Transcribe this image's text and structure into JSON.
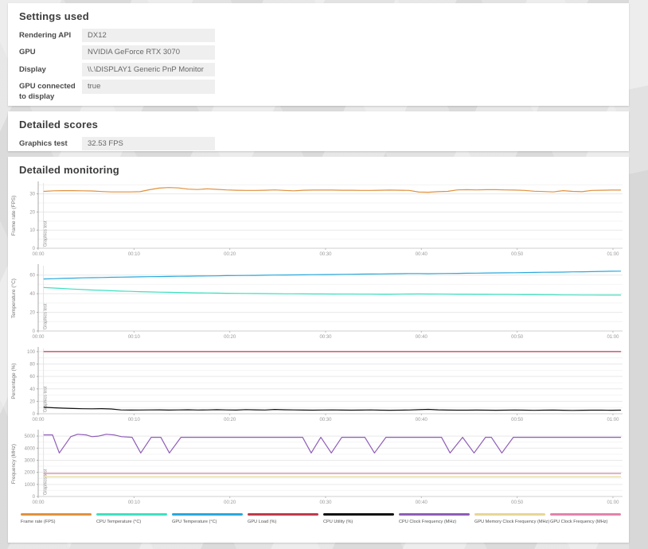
{
  "settings_card": {
    "title": "Settings used",
    "rows": [
      {
        "label": "Rendering API",
        "value": "DX12"
      },
      {
        "label": "GPU",
        "value": "NVIDIA GeForce RTX 3070"
      },
      {
        "label": "Display",
        "value": "\\\\.\\DISPLAY1 Generic PnP Monitor"
      },
      {
        "label": "GPU connected to display",
        "value": "true"
      }
    ]
  },
  "scores_card": {
    "title": "Detailed scores",
    "rows": [
      {
        "label": "Graphics test",
        "value": "32.53 FPS"
      }
    ]
  },
  "monitoring_card": {
    "title": "Detailed monitoring"
  },
  "legend": [
    {
      "name": "Frame rate (FPS)",
      "color": "#e0913d"
    },
    {
      "name": "CPU Temperature (°C)",
      "color": "#3fe0c0"
    },
    {
      "name": "GPU Temperature (°C)",
      "color": "#29a9dc"
    },
    {
      "name": "GPU Load (%)",
      "color": "#bf3a4a"
    },
    {
      "name": "CPU Utility (%)",
      "color": "#111111"
    },
    {
      "name": "CPU Clock Frequency (MHz)",
      "color": "#8f5cb8"
    },
    {
      "name": "GPU Memory Clock Frequency (MHz)",
      "color": "#e6d795"
    },
    {
      "name": "GPU Clock Frequency (MHz)",
      "color": "#e383ab"
    }
  ],
  "chart_data": {
    "type": "line",
    "x_axis": {
      "ticks": [
        "00:00",
        "00:10",
        "00:20",
        "00:30",
        "00:40",
        "00:50",
        "01:00"
      ],
      "t_values": [
        0,
        10,
        20,
        30,
        40,
        50,
        60
      ],
      "t_max": 61,
      "t_start": 0.6,
      "t_end": 60.8,
      "marker_t": 0.55,
      "marker_label": "Graphics test"
    },
    "charts": [
      {
        "id": "frame-rate",
        "ylabel": "Frame rate (FPS)",
        "ymax": 36,
        "yticks": [
          0,
          10,
          20,
          30
        ],
        "series": [
          {
            "name": "Frame rate (FPS)",
            "color": "#e0913d",
            "values": [
              31.4,
              31.7,
              31.8,
              31.8,
              31.7,
              31.6,
              31.3,
              31.1,
              31.1,
              31.1,
              31.2,
              32.3,
              33.2,
              33.5,
              33.3,
              32.6,
              32.4,
              32.8,
              32.5,
              32.2,
              32.0,
              31.9,
              31.9,
              32.0,
              32.2,
              31.9,
              31.7,
              32.0,
              32.1,
              32.1,
              32.1,
              32.0,
              32.0,
              31.9,
              31.9,
              32.0,
              32.1,
              32.0,
              31.9,
              31.0,
              30.9,
              31.2,
              31.4,
              32.2,
              32.3,
              32.2,
              32.3,
              32.3,
              32.2,
              32.1,
              31.9,
              31.5,
              31.3,
              31.1,
              31.8,
              31.4,
              31.2,
              31.9,
              32.0,
              32.1,
              32.1
            ]
          }
        ]
      },
      {
        "id": "temperature",
        "ylabel": "Temperature (°C)",
        "ymax": 70,
        "yticks": [
          0,
          20,
          40,
          60
        ],
        "series": [
          {
            "name": "GPU Temperature (°C)",
            "color": "#29a9dc",
            "values": [
              55.8,
              56.1,
              56.4,
              56.7,
              57.0,
              57.2,
              57.4,
              57.6,
              57.8,
              58.0,
              58.1,
              58.3,
              58.4,
              58.6,
              58.7,
              58.8,
              59.0,
              59.1,
              59.2,
              59.4,
              59.5,
              59.6,
              59.7,
              59.8,
              60.0,
              60.1,
              60.2,
              60.3,
              60.4,
              60.5,
              60.6,
              60.8,
              60.9,
              61.0,
              61.1,
              61.2,
              61.4,
              61.5,
              61.6,
              61.6,
              61.5,
              61.6,
              61.7,
              61.8,
              62.0,
              62.1,
              62.2,
              62.3,
              62.4,
              62.5,
              62.7,
              62.8,
              63.0,
              63.1,
              63.2,
              63.4,
              63.5,
              63.7,
              63.9,
              64.1,
              64.2
            ]
          },
          {
            "name": "CPU Temperature (°C)",
            "color": "#3fe0c0",
            "values": [
              46.6,
              46.1,
              45.6,
              45.0,
              44.5,
              44.0,
              43.6,
              43.2,
              42.8,
              42.5,
              42.2,
              41.9,
              41.7,
              41.5,
              41.3,
              41.1,
              40.9,
              40.8,
              40.6,
              40.5,
              40.4,
              40.3,
              40.2,
              40.1,
              40.0,
              39.9,
              39.9,
              39.8,
              39.7,
              39.7,
              39.6,
              39.5,
              39.5,
              39.4,
              39.4,
              39.3,
              39.3,
              39.4,
              39.6,
              39.7,
              39.6,
              39.5,
              39.4,
              39.3,
              39.3,
              39.2,
              39.2,
              39.1,
              39.1,
              39.0,
              38.9,
              38.9,
              38.8,
              38.8,
              38.7,
              38.7,
              38.6,
              38.6,
              38.5,
              38.5,
              38.5
            ]
          }
        ]
      },
      {
        "id": "percentage",
        "ylabel": "Percentage (%)",
        "ymax": 105,
        "yticks": [
          0,
          20,
          40,
          60,
          80,
          100
        ],
        "series": [
          {
            "name": "GPU Load (%)",
            "color": "#bf3a4a",
            "points": [
              [
                0.6,
                100
              ],
              [
                60.8,
                100
              ]
            ]
          },
          {
            "name": "CPU Utility (%)",
            "color": "#111111",
            "values": [
              10.4,
              9.6,
              8.9,
              8.4,
              8.1,
              7.9,
              8.2,
              7.7,
              6.1,
              5.9,
              6.0,
              6.1,
              6.3,
              5.9,
              6.1,
              6.4,
              6.0,
              6.2,
              6.5,
              6.1,
              5.9,
              6.6,
              6.3,
              6.0,
              6.9,
              6.4,
              6.1,
              5.9,
              5.8,
              6.0,
              6.2,
              5.9,
              5.7,
              5.9,
              6.1,
              5.8,
              5.6,
              5.7,
              6.0,
              6.5,
              7.0,
              6.3,
              5.9,
              5.7,
              5.8,
              5.9,
              5.7,
              5.6,
              5.8,
              6.0,
              5.7,
              5.5,
              5.7,
              5.9,
              5.6,
              5.4,
              5.6,
              5.8,
              5.7,
              5.6,
              5.7
            ]
          }
        ]
      },
      {
        "id": "frequency",
        "ylabel": "Frequency (MHz)",
        "ymax": 5400,
        "yticks": [
          0,
          1000,
          2000,
          3000,
          4000,
          5000
        ],
        "series": [
          {
            "name": "GPU Memory Clock Frequency (MHz)",
            "color": "#e6d795",
            "points": [
              [
                0.6,
                1620
              ],
              [
                60.8,
                1620
              ]
            ]
          },
          {
            "name": "GPU Clock Frequency (MHz)",
            "color": "#e383ab",
            "points": [
              [
                0.6,
                1900
              ],
              [
                60.8,
                1900
              ]
            ]
          },
          {
            "name": "CPU Clock Frequency (MHz)",
            "color": "#8f5cb8",
            "points": [
              [
                0.6,
                5100
              ],
              [
                1.5,
                5100
              ],
              [
                2.2,
                3600
              ],
              [
                3.4,
                4950
              ],
              [
                4.1,
                5150
              ],
              [
                5.0,
                5100
              ],
              [
                5.6,
                4950
              ],
              [
                6.3,
                5000
              ],
              [
                7.1,
                5150
              ],
              [
                7.9,
                5100
              ],
              [
                8.7,
                4950
              ],
              [
                9.8,
                4900
              ],
              [
                10.7,
                3600
              ],
              [
                11.8,
                4900
              ],
              [
                12.8,
                4900
              ],
              [
                13.7,
                3600
              ],
              [
                14.9,
                4900
              ],
              [
                27.6,
                4900
              ],
              [
                28.5,
                3600
              ],
              [
                29.5,
                4900
              ],
              [
                30.6,
                3600
              ],
              [
                31.7,
                4900
              ],
              [
                34.1,
                4900
              ],
              [
                35.1,
                3600
              ],
              [
                36.3,
                4900
              ],
              [
                42.1,
                4900
              ],
              [
                43.0,
                3600
              ],
              [
                44.3,
                4900
              ],
              [
                45.5,
                3600
              ],
              [
                46.7,
                4900
              ],
              [
                47.3,
                4900
              ],
              [
                48.4,
                3600
              ],
              [
                49.6,
                4900
              ],
              [
                60.8,
                4900
              ]
            ]
          }
        ]
      }
    ]
  }
}
